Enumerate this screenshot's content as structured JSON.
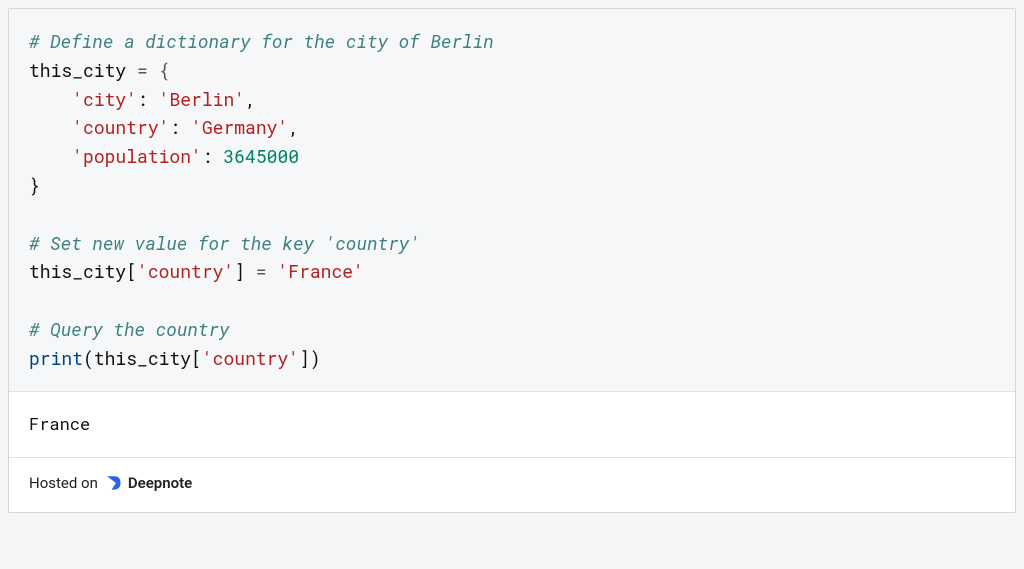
{
  "code": {
    "comment1": "# Define a dictionary for the city of Berlin",
    "var": "this_city",
    "assign": " = {",
    "line_city_key": "'city'",
    "line_city_val": "'Berlin'",
    "line_country_key": "'country'",
    "line_country_val": "'Germany'",
    "line_pop_key": "'population'",
    "line_pop_val": "3645000",
    "close_brace": "}",
    "comment2": "# Set new value for the key 'country'",
    "set_lhs_var": "this_city",
    "set_lhs_key": "'country'",
    "set_rhs": "'France'",
    "comment3": "# Query the country",
    "print_fn": "print",
    "print_var": "this_city",
    "print_key": "'country'"
  },
  "output": {
    "text": "France"
  },
  "footer": {
    "prefix": "Hosted on ",
    "brand": "Deepnote"
  }
}
